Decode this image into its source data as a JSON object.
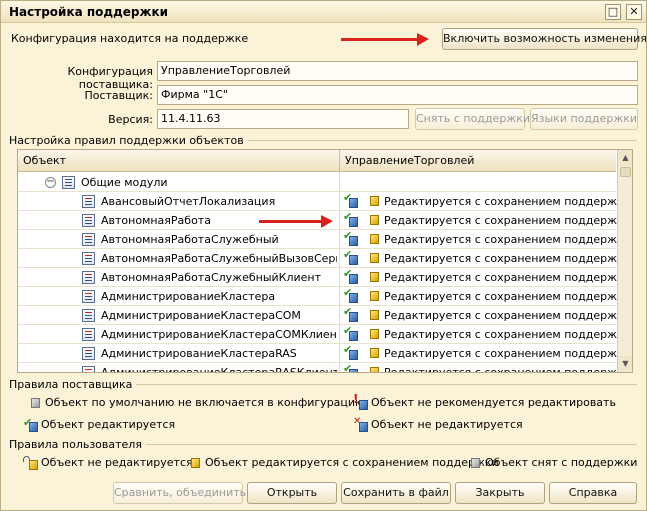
{
  "window": {
    "title": "Настройка поддержки",
    "maximize_glyph": "□",
    "close_glyph": "✕"
  },
  "header": {
    "status_text": "Конфигурация находится на поддержке",
    "enable_changes_button": "Включить возможность изменения"
  },
  "fields": {
    "vendor_config_label": "Конфигурация поставщика:",
    "vendor_config_value": "УправлениеТорговлей",
    "vendor_label": "Поставщик:",
    "vendor_value": "Фирма \"1С\"",
    "version_label": "Версия:",
    "version_value": "11.4.11.63",
    "remove_support_button": "Снять с поддержки",
    "support_languages_button": "Языки поддержки"
  },
  "rules_group": {
    "title": "Настройка правил поддержки объектов"
  },
  "grid": {
    "columns": [
      "Объект",
      "УправлениеТорговлей"
    ],
    "root": {
      "label": "Общие модули",
      "expanded": true,
      "toggle_glyph": "−"
    },
    "rows": [
      {
        "name": "АвансовыйОтчетЛокализация",
        "state": "Редактируется с сохранением поддержки"
      },
      {
        "name": "АвтономнаяРабота",
        "state": "Редактируется с сохранением поддержки"
      },
      {
        "name": "АвтономнаяРаботаСлужебный",
        "state": "Редактируется с сохранением поддержки"
      },
      {
        "name": "АвтономнаяРаботаСлужебныйВызовСервера",
        "state": "Редактируется с сохранением поддержки"
      },
      {
        "name": "АвтономнаяРаботаСлужебныйКлиент",
        "state": "Редактируется с сохранением поддержки"
      },
      {
        "name": "АдминистрированиеКластера",
        "state": "Редактируется с сохранением поддержки"
      },
      {
        "name": "АдминистрированиеКластераCOM",
        "state": "Редактируется с сохранением поддержки"
      },
      {
        "name": "АдминистрированиеКластераCOMКлиентСе...",
        "state": "Редактируется с сохранением поддержки"
      },
      {
        "name": "АдминистрированиеКластераRAS",
        "state": "Редактируется с сохранением поддержки"
      },
      {
        "name": "АдминистрированиеКластераRASКлиентСе...",
        "state": "Редактируется с сохранением поддержки"
      }
    ],
    "scroll_up_glyph": "▲",
    "scroll_down_glyph": "▼"
  },
  "legend": {
    "vendor_rules_title": "Правила поставщика",
    "vendor_rules": {
      "not_included": "Объект по умолчанию не включается в конфигурацию",
      "not_recommended": "Объект не рекомендуется редактировать",
      "editable": "Объект редактируется",
      "not_editable": "Объект не редактируется"
    },
    "user_rules_title": "Правила пользователя",
    "user_rules": {
      "not_editable": "Объект не редактируется",
      "editable_keep_support": "Объект редактируется с сохранением поддержки",
      "removed_from_support": "Объект снят с поддержки"
    },
    "glyphs": {
      "check": "✔",
      "exclamation": "!",
      "cross": "✕"
    }
  },
  "footer": {
    "compare_merge": "Сравнить, объединить",
    "open": "Открыть",
    "save_to_file": "Сохранить в файл",
    "close": "Закрыть",
    "help": "Справка"
  },
  "colors": {
    "background": "#fbf3d8",
    "arrow": "#d9221c"
  }
}
